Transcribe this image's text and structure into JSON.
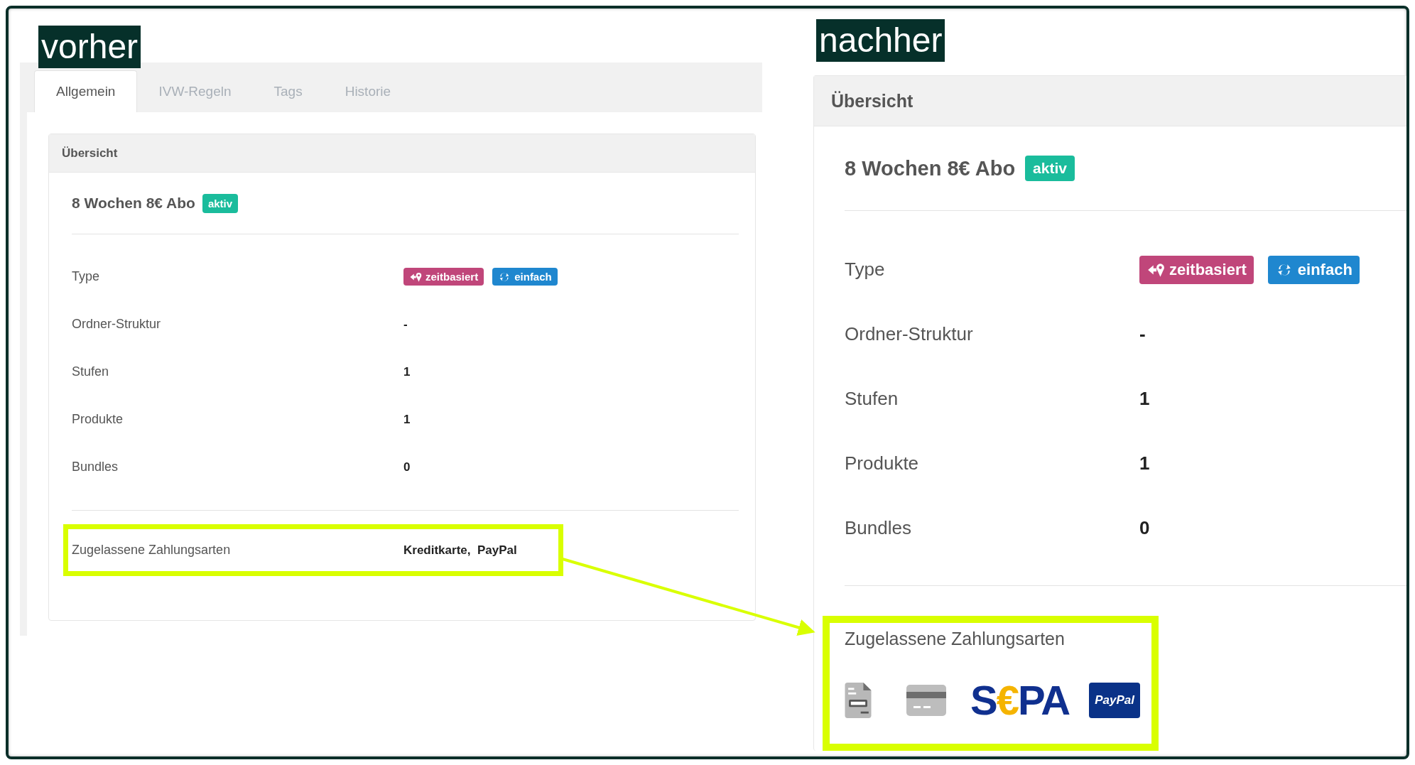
{
  "panels": [
    {
      "label": "vorher",
      "kind": "small",
      "tabs": [
        {
          "label": "Allgemein",
          "selected": true
        },
        {
          "label": "IVW-Regeln",
          "selected": false
        },
        {
          "label": "Tags",
          "selected": false
        },
        {
          "label": "Historie",
          "selected": false
        }
      ],
      "card": {
        "header": "Übersicht",
        "title": "8 Wochen 8€ Abo",
        "status": "aktiv",
        "rows": [
          {
            "label": "Type",
            "badges": [
              {
                "kind": "time",
                "text": "zeitbasiert"
              },
              {
                "kind": "repeat",
                "text": "einfach"
              }
            ]
          },
          {
            "label": "Ordner-Struktur",
            "value": "-"
          },
          {
            "label": "Stufen",
            "value": "1"
          },
          {
            "label": "Produkte",
            "value": "1"
          },
          {
            "label": "Bundles",
            "value": "0"
          }
        ],
        "payment": {
          "label": "Zugelassene Zahlungsarten",
          "value": "Kreditkarte,  PayPal"
        }
      }
    },
    {
      "label": "nachher",
      "kind": "large",
      "card": {
        "header": "Übersicht",
        "title": "8 Wochen 8€ Abo",
        "status": "aktiv",
        "rows": [
          {
            "label": "Type",
            "badges": [
              {
                "kind": "time",
                "text": "zeitbasiert"
              },
              {
                "kind": "repeat",
                "text": "einfach"
              }
            ]
          },
          {
            "label": "Ordner-Struktur",
            "value": "-"
          },
          {
            "label": "Stufen",
            "value": "1"
          },
          {
            "label": "Produkte",
            "value": "1"
          },
          {
            "label": "Bundles",
            "value": "0"
          }
        ],
        "payment": {
          "label": "Zugelassene Zahlungsarten",
          "methods": [
            {
              "kind": "invoice"
            },
            {
              "kind": "card"
            },
            {
              "kind": "sepa",
              "parts": [
                "S",
                "€",
                "PA"
              ]
            },
            {
              "kind": "paypal",
              "text": "PayPal"
            }
          ]
        }
      }
    }
  ]
}
